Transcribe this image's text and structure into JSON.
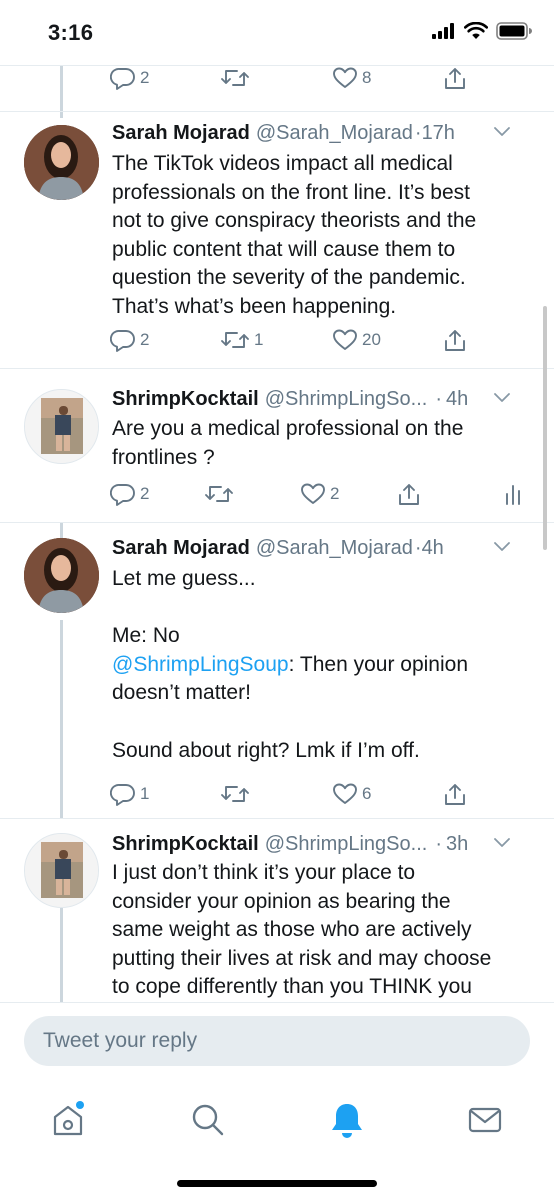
{
  "status_bar": {
    "time": "3:16"
  },
  "thread": {
    "top_actions": {
      "reply_count": "2",
      "retweet_count": "",
      "like_count": "8"
    },
    "tweets": [
      {
        "name": "Sarah Mojarad",
        "handle": "@Sarah_Mojarad",
        "time": "17h",
        "body": [
          "The TikTok videos impact all medical",
          "professionals on the front line. It’s best",
          "not to give conspiracy theorists and the",
          "public content that will cause them to",
          "question the severity of the pandemic.",
          "That’s what’s been happening."
        ],
        "reply_count": "2",
        "retweet_count": "1",
        "like_count": "20"
      },
      {
        "name": "ShrimpKocktail",
        "handle": "@ShrimpLingSo...",
        "time": "4h",
        "body": [
          "Are you a medical professional on the",
          "frontlines ?"
        ],
        "reply_count": "2",
        "retweet_count": "",
        "like_count": "2"
      },
      {
        "name": "Sarah Mojarad",
        "handle": "@Sarah_Mojarad",
        "time": "4h",
        "body": [
          "Let me guess...",
          "",
          "Me: No",
          "",
          "doesn’t matter!",
          "",
          "Sound about right? Lmk if I’m off."
        ],
        "mention_handle": "@ShrimpLingSoup",
        "mention_rest": ": Then your opinion",
        "reply_count": "1",
        "retweet_count": "",
        "like_count": "6"
      },
      {
        "name": "ShrimpKocktail",
        "handle": "@ShrimpLingSo...",
        "time": "3h",
        "body": [
          "I just don’t think it’s your place to",
          "consider your opinion as bearing the",
          "same weight as those who are actively",
          "putting their lives at risk and may choose",
          "to cope differently than you THINK you"
        ]
      }
    ]
  },
  "reply": {
    "placeholder": "Tweet your reply"
  },
  "tab_bar": {
    "items": [
      {
        "icon": "home-icon",
        "has_notification_dot": true
      },
      {
        "icon": "search-icon"
      },
      {
        "icon": "bell-icon",
        "active": true
      },
      {
        "icon": "mail-icon"
      }
    ]
  },
  "colors": {
    "accent": "#1da1f2",
    "text": "#14171a",
    "secondary_text": "#657786",
    "divider": "#e6ecf0",
    "thread_line": "#ccd6dd"
  }
}
